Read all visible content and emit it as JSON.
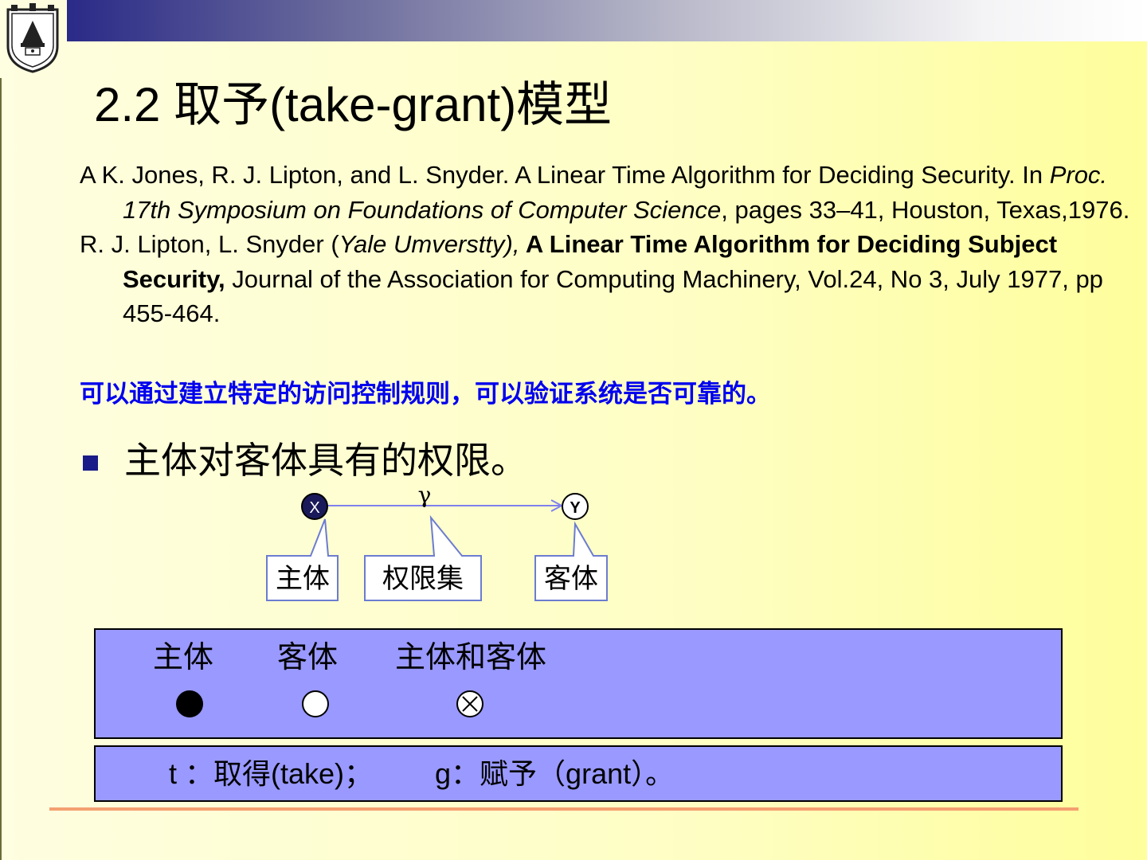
{
  "slide": {
    "title": "2.2 取予(take-grant)模型",
    "references": [
      {
        "text1": "A K. Jones, R. J. Lipton, and L. Snyder. A Linear Time Algorithm for Deciding Security. In ",
        "italic": "Proc. 17th Symposium on Foundations of Computer Science",
        "text2": ", pages 33–41, Houston, Texas,1976."
      },
      {
        "text1": "R. J. Lipton, L. Snyder (",
        "italic": "Yale Umverstty),",
        "bold": " A Linear Time Algorithm for Deciding Subject Security,",
        "text2": " Journal of the Association for Computing Machinery, Vol.24, No 3, July 1977, pp 455-464."
      }
    ],
    "note": "可以通过建立特定的访问控制规则，可以验证系统是否可靠的。",
    "bullet": "主体对客体具有的权限。",
    "diagram": {
      "node_x": "X",
      "node_y": "Y",
      "edge_label": "γ",
      "callout_subject": "主体",
      "callout_rights": "权限集",
      "callout_object": "客体"
    },
    "legend": {
      "subject_label": "主体",
      "object_label": "客体",
      "both_label": "主体和客体"
    },
    "operations": {
      "take": "t ：取得(take)；",
      "grant": "g：赋予（grant）。"
    },
    "colors": {
      "title_bar_start": "#2a2a88",
      "note_text": "#0000ee",
      "panel_fill": "#9999ff",
      "bottom_rule": "#f4a070",
      "arrow": "#8080ee"
    },
    "icons": [
      "university-seal-icon",
      "square-bullet-icon",
      "filled-circle-icon",
      "empty-circle-icon",
      "crossed-circle-icon"
    ]
  }
}
